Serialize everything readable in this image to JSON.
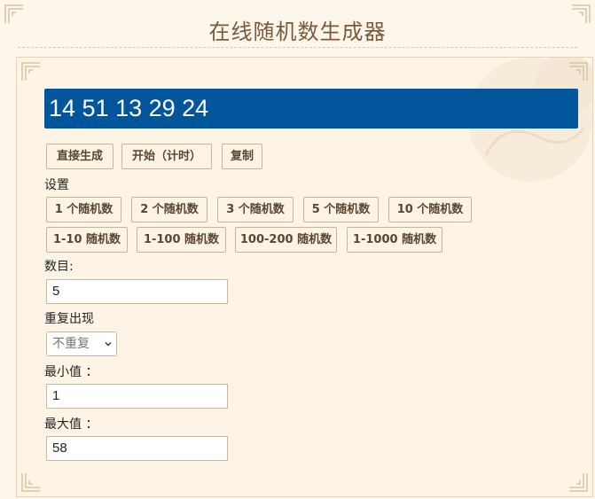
{
  "page": {
    "title": "在线随机数生成器"
  },
  "result": {
    "value": "14 51 13 29 24"
  },
  "actions": {
    "generate": "直接生成",
    "start_timed": "开始（计时）",
    "copy": "复制"
  },
  "settings": {
    "label": "设置",
    "presets_count": [
      "1 个随机数",
      "2 个随机数",
      "3 个随机数",
      "5 个随机数",
      "10 个随机数"
    ],
    "presets_range": [
      "1-10 随机数",
      "1-100 随机数",
      "100-200 随机数",
      "1-1000 随机数"
    ]
  },
  "form": {
    "count_label": "数目:",
    "count_value": "5",
    "repeat_label": "重复出现",
    "repeat_selected": "不重复",
    "min_label": "最小值 ：",
    "min_value": "1",
    "max_label": "最大值 ：",
    "max_value": "58"
  },
  "colors": {
    "result_bg": "#00559b",
    "page_bg": "#fdf6ea",
    "title": "#7a5a3a"
  }
}
